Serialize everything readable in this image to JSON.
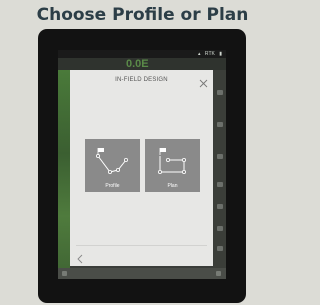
{
  "page": {
    "heading": "Choose Profile or Plan"
  },
  "status_bar": {
    "left_text": "",
    "rtk_label": "RTK"
  },
  "background": {
    "speed_readout": "0.0E"
  },
  "dialog": {
    "title": "IN-FIELD DESIGN",
    "options": [
      {
        "label": "Profile",
        "icon": "profile-path-icon"
      },
      {
        "label": "Plan",
        "icon": "plan-path-icon"
      }
    ],
    "close_icon": "close-icon",
    "back_icon": "chevron-left-icon"
  },
  "colors": {
    "heading": "#2c3e47",
    "dialog_bg": "#e7e7e5",
    "tile_bg": "#8a8a8a",
    "field_green": "#4a7a3a"
  }
}
